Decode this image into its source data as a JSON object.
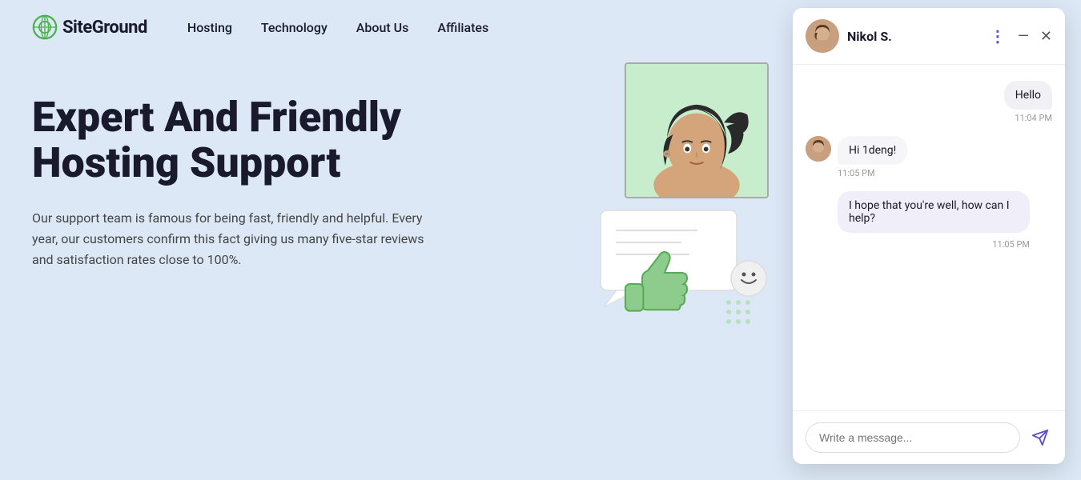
{
  "header": {
    "logo_text": "SiteGround",
    "nav_items": [
      {
        "label": "Hosting",
        "href": "#"
      },
      {
        "label": "Technology",
        "href": "#"
      },
      {
        "label": "About Us",
        "href": "#"
      },
      {
        "label": "Affiliates",
        "href": "#"
      }
    ]
  },
  "hero": {
    "title": "Expert And Friendly Hosting Support",
    "description": "Our support team is famous for being fast, friendly and helpful. Every year, our customers confirm this fact giving us many five-star reviews and satisfaction rates close to 100%."
  },
  "chat": {
    "agent_name": "Nikol S.",
    "messages": [
      {
        "type": "right",
        "text": "Hello",
        "time": "11:04 PM"
      },
      {
        "type": "left",
        "text": "Hi 1deng!",
        "time": "11:05 PM"
      },
      {
        "type": "left",
        "text": "I hope that you're well, how can I help?",
        "time": "11:05 PM"
      }
    ],
    "input_placeholder": "Write a message...",
    "header_actions": [
      "more-icon",
      "minimize-icon",
      "close-icon"
    ]
  }
}
